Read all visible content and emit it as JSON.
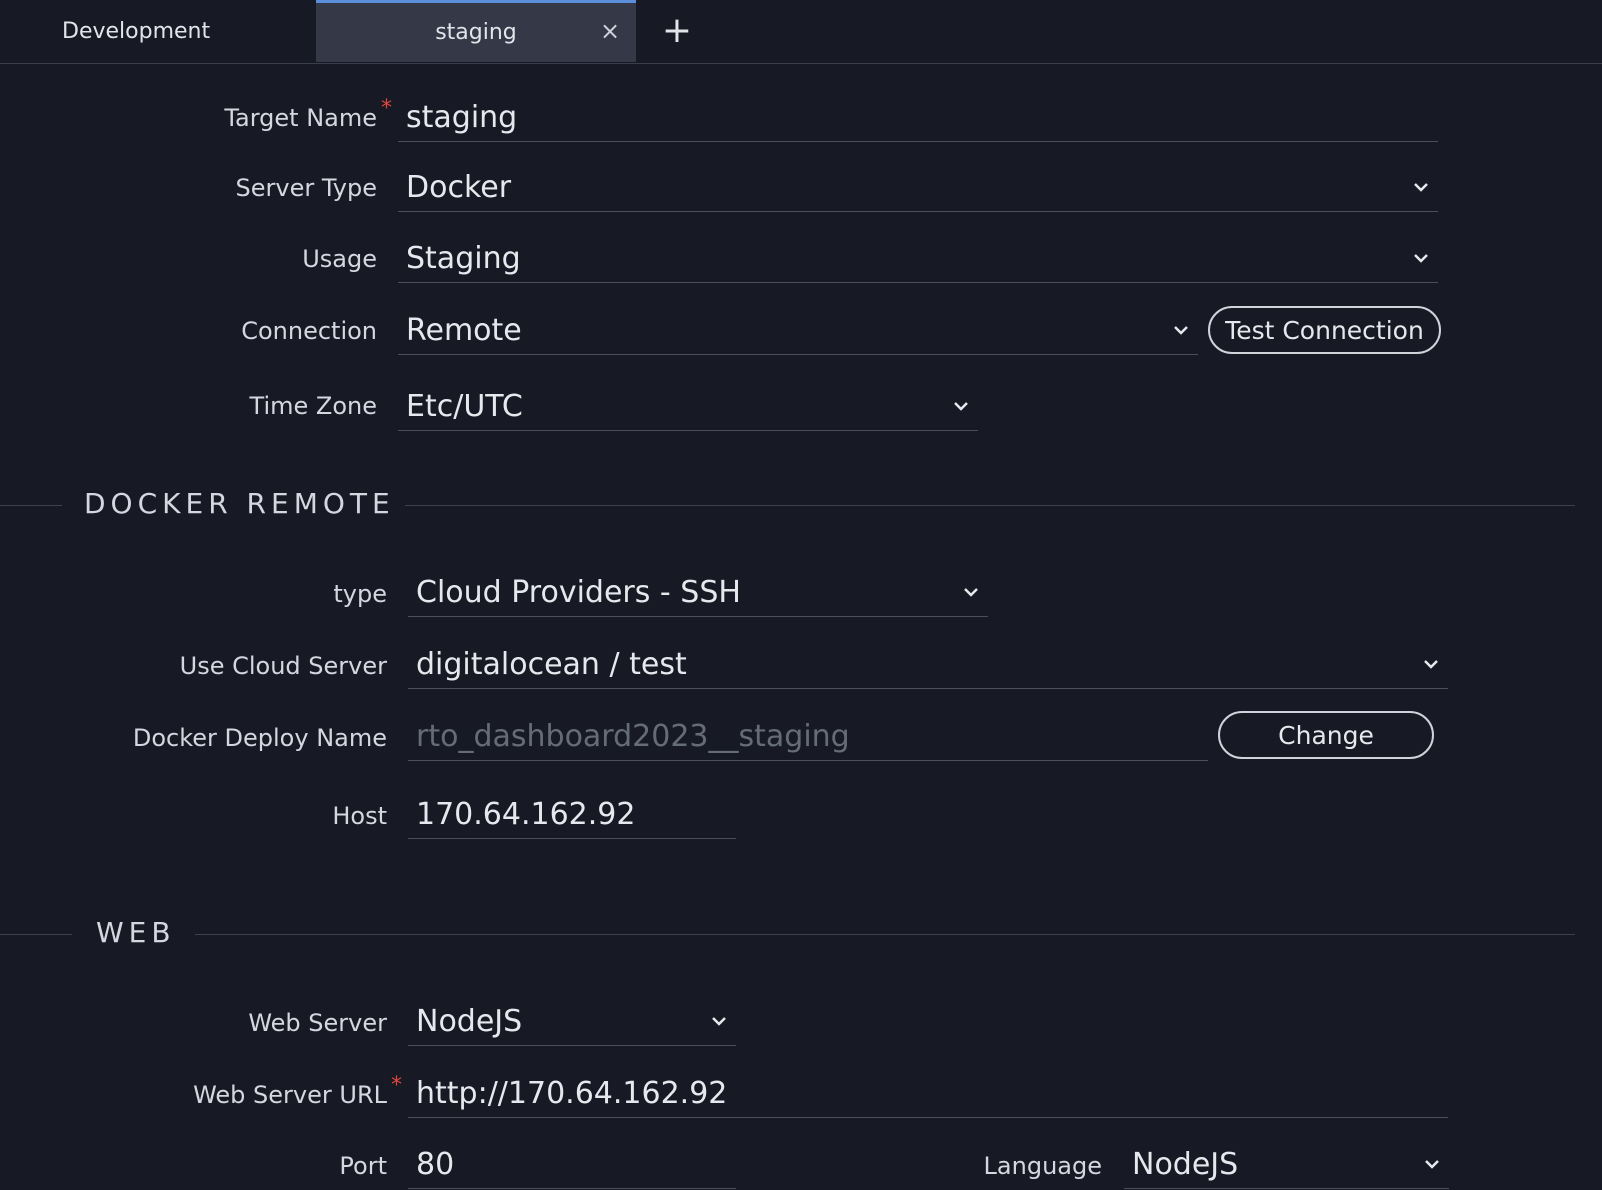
{
  "tabs": [
    {
      "label": "Development"
    },
    {
      "label": "staging"
    }
  ],
  "tab_close_glyph": "×",
  "tab_add_glyph": "+",
  "form": {
    "target_name": {
      "label": "Target Name",
      "required": "*",
      "value": "staging"
    },
    "server_type": {
      "label": "Server Type",
      "value": "Docker"
    },
    "usage": {
      "label": "Usage",
      "value": "Staging"
    },
    "connection": {
      "label": "Connection",
      "value": "Remote",
      "button": "Test Connection"
    },
    "time_zone": {
      "label": "Time Zone",
      "value": "Etc/UTC"
    }
  },
  "docker_remote": {
    "title": "DOCKER REMOTE",
    "type": {
      "label": "type",
      "value": "Cloud Providers - SSH"
    },
    "cloud_server": {
      "label": "Use Cloud Server",
      "value": "digitalocean / test"
    },
    "deploy_name": {
      "label": "Docker Deploy Name",
      "placeholder": "rto_dashboard2023__staging",
      "button": "Change"
    },
    "host": {
      "label": "Host",
      "value": "170.64.162.92"
    }
  },
  "web": {
    "title": "WEB",
    "web_server": {
      "label": "Web Server",
      "value": "NodeJS"
    },
    "web_server_url": {
      "label": "Web Server URL",
      "required": "*",
      "value": "http://170.64.162.92"
    },
    "port": {
      "label": "Port",
      "value": "80"
    },
    "language": {
      "label": "Language",
      "value": "NodeJS"
    }
  },
  "colors": {
    "background": "#171a24",
    "active_tab": "#353947",
    "accent": "#5b8fd9",
    "required": "#e0463d"
  }
}
